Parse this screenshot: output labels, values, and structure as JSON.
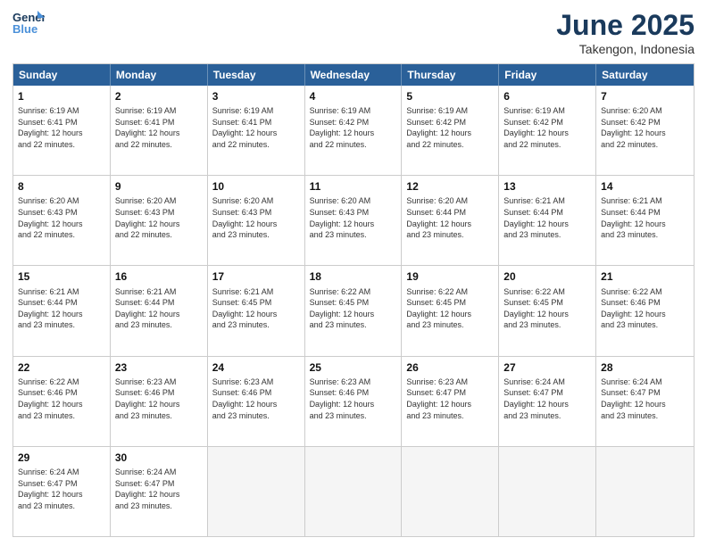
{
  "logo": {
    "line1": "General",
    "line2": "Blue"
  },
  "title": "June 2025",
  "subtitle": "Takengon, Indonesia",
  "header_days": [
    "Sunday",
    "Monday",
    "Tuesday",
    "Wednesday",
    "Thursday",
    "Friday",
    "Saturday"
  ],
  "rows": [
    [
      {
        "day": "1",
        "info": "Sunrise: 6:19 AM\nSunset: 6:41 PM\nDaylight: 12 hours\nand 22 minutes."
      },
      {
        "day": "2",
        "info": "Sunrise: 6:19 AM\nSunset: 6:41 PM\nDaylight: 12 hours\nand 22 minutes."
      },
      {
        "day": "3",
        "info": "Sunrise: 6:19 AM\nSunset: 6:41 PM\nDaylight: 12 hours\nand 22 minutes."
      },
      {
        "day": "4",
        "info": "Sunrise: 6:19 AM\nSunset: 6:42 PM\nDaylight: 12 hours\nand 22 minutes."
      },
      {
        "day": "5",
        "info": "Sunrise: 6:19 AM\nSunset: 6:42 PM\nDaylight: 12 hours\nand 22 minutes."
      },
      {
        "day": "6",
        "info": "Sunrise: 6:19 AM\nSunset: 6:42 PM\nDaylight: 12 hours\nand 22 minutes."
      },
      {
        "day": "7",
        "info": "Sunrise: 6:20 AM\nSunset: 6:42 PM\nDaylight: 12 hours\nand 22 minutes."
      }
    ],
    [
      {
        "day": "8",
        "info": "Sunrise: 6:20 AM\nSunset: 6:43 PM\nDaylight: 12 hours\nand 22 minutes."
      },
      {
        "day": "9",
        "info": "Sunrise: 6:20 AM\nSunset: 6:43 PM\nDaylight: 12 hours\nand 22 minutes."
      },
      {
        "day": "10",
        "info": "Sunrise: 6:20 AM\nSunset: 6:43 PM\nDaylight: 12 hours\nand 23 minutes."
      },
      {
        "day": "11",
        "info": "Sunrise: 6:20 AM\nSunset: 6:43 PM\nDaylight: 12 hours\nand 23 minutes."
      },
      {
        "day": "12",
        "info": "Sunrise: 6:20 AM\nSunset: 6:44 PM\nDaylight: 12 hours\nand 23 minutes."
      },
      {
        "day": "13",
        "info": "Sunrise: 6:21 AM\nSunset: 6:44 PM\nDaylight: 12 hours\nand 23 minutes."
      },
      {
        "day": "14",
        "info": "Sunrise: 6:21 AM\nSunset: 6:44 PM\nDaylight: 12 hours\nand 23 minutes."
      }
    ],
    [
      {
        "day": "15",
        "info": "Sunrise: 6:21 AM\nSunset: 6:44 PM\nDaylight: 12 hours\nand 23 minutes."
      },
      {
        "day": "16",
        "info": "Sunrise: 6:21 AM\nSunset: 6:44 PM\nDaylight: 12 hours\nand 23 minutes."
      },
      {
        "day": "17",
        "info": "Sunrise: 6:21 AM\nSunset: 6:45 PM\nDaylight: 12 hours\nand 23 minutes."
      },
      {
        "day": "18",
        "info": "Sunrise: 6:22 AM\nSunset: 6:45 PM\nDaylight: 12 hours\nand 23 minutes."
      },
      {
        "day": "19",
        "info": "Sunrise: 6:22 AM\nSunset: 6:45 PM\nDaylight: 12 hours\nand 23 minutes."
      },
      {
        "day": "20",
        "info": "Sunrise: 6:22 AM\nSunset: 6:45 PM\nDaylight: 12 hours\nand 23 minutes."
      },
      {
        "day": "21",
        "info": "Sunrise: 6:22 AM\nSunset: 6:46 PM\nDaylight: 12 hours\nand 23 minutes."
      }
    ],
    [
      {
        "day": "22",
        "info": "Sunrise: 6:22 AM\nSunset: 6:46 PM\nDaylight: 12 hours\nand 23 minutes."
      },
      {
        "day": "23",
        "info": "Sunrise: 6:23 AM\nSunset: 6:46 PM\nDaylight: 12 hours\nand 23 minutes."
      },
      {
        "day": "24",
        "info": "Sunrise: 6:23 AM\nSunset: 6:46 PM\nDaylight: 12 hours\nand 23 minutes."
      },
      {
        "day": "25",
        "info": "Sunrise: 6:23 AM\nSunset: 6:46 PM\nDaylight: 12 hours\nand 23 minutes."
      },
      {
        "day": "26",
        "info": "Sunrise: 6:23 AM\nSunset: 6:47 PM\nDaylight: 12 hours\nand 23 minutes."
      },
      {
        "day": "27",
        "info": "Sunrise: 6:24 AM\nSunset: 6:47 PM\nDaylight: 12 hours\nand 23 minutes."
      },
      {
        "day": "28",
        "info": "Sunrise: 6:24 AM\nSunset: 6:47 PM\nDaylight: 12 hours\nand 23 minutes."
      }
    ],
    [
      {
        "day": "29",
        "info": "Sunrise: 6:24 AM\nSunset: 6:47 PM\nDaylight: 12 hours\nand 23 minutes."
      },
      {
        "day": "30",
        "info": "Sunrise: 6:24 AM\nSunset: 6:47 PM\nDaylight: 12 hours\nand 23 minutes."
      },
      {
        "day": "",
        "info": ""
      },
      {
        "day": "",
        "info": ""
      },
      {
        "day": "",
        "info": ""
      },
      {
        "day": "",
        "info": ""
      },
      {
        "day": "",
        "info": ""
      }
    ]
  ]
}
